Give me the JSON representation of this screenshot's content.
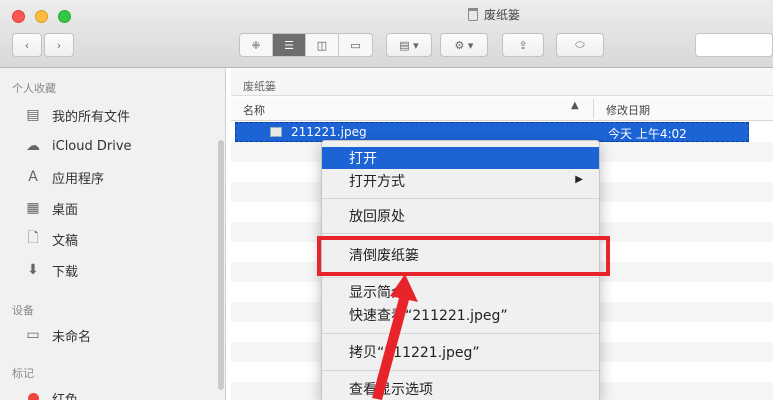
{
  "window": {
    "title": "废纸篓"
  },
  "toolbar": {
    "back_icon": "chevron-left-icon",
    "forward_icon": "chevron-right-icon",
    "view_modes": [
      "icon-view",
      "list-view",
      "column-view",
      "cover-flow-view"
    ],
    "active_view": "list-view"
  },
  "sidebar": {
    "favorites_label": "个人收藏",
    "favorites": [
      {
        "label": "我的所有文件",
        "icon": "all-files-icon"
      },
      {
        "label": "iCloud Drive",
        "icon": "cloud-icon"
      },
      {
        "label": "应用程序",
        "icon": "applications-icon"
      },
      {
        "label": "桌面",
        "icon": "desktop-icon"
      },
      {
        "label": "文稿",
        "icon": "documents-icon"
      },
      {
        "label": "下载",
        "icon": "download-icon"
      }
    ],
    "devices_label": "设备",
    "devices": [
      {
        "label": "未命名",
        "icon": "disk-icon"
      }
    ],
    "tags_label": "标记",
    "tags": [
      {
        "label": "红色",
        "color": "#f0443d"
      }
    ]
  },
  "main": {
    "path": "废纸篓",
    "columns": {
      "name": "名称",
      "date": "修改日期"
    },
    "selected_file": {
      "name": "211221.jpeg",
      "date": "今天 上午4:02"
    }
  },
  "context_menu": {
    "items": [
      {
        "label": "打开"
      },
      {
        "label": "打开方式"
      },
      {
        "label": "放回原处"
      },
      {
        "label": "清倒废纸篓"
      },
      {
        "label": "显示简介"
      },
      {
        "label": "快速查看“211221.jpeg”"
      },
      {
        "label": "拷贝“211221.jpeg”"
      },
      {
        "label": "查看显示选项"
      }
    ],
    "highlight_color": "#1c63d6"
  },
  "annotation": {
    "box_color": "#e8242b"
  }
}
